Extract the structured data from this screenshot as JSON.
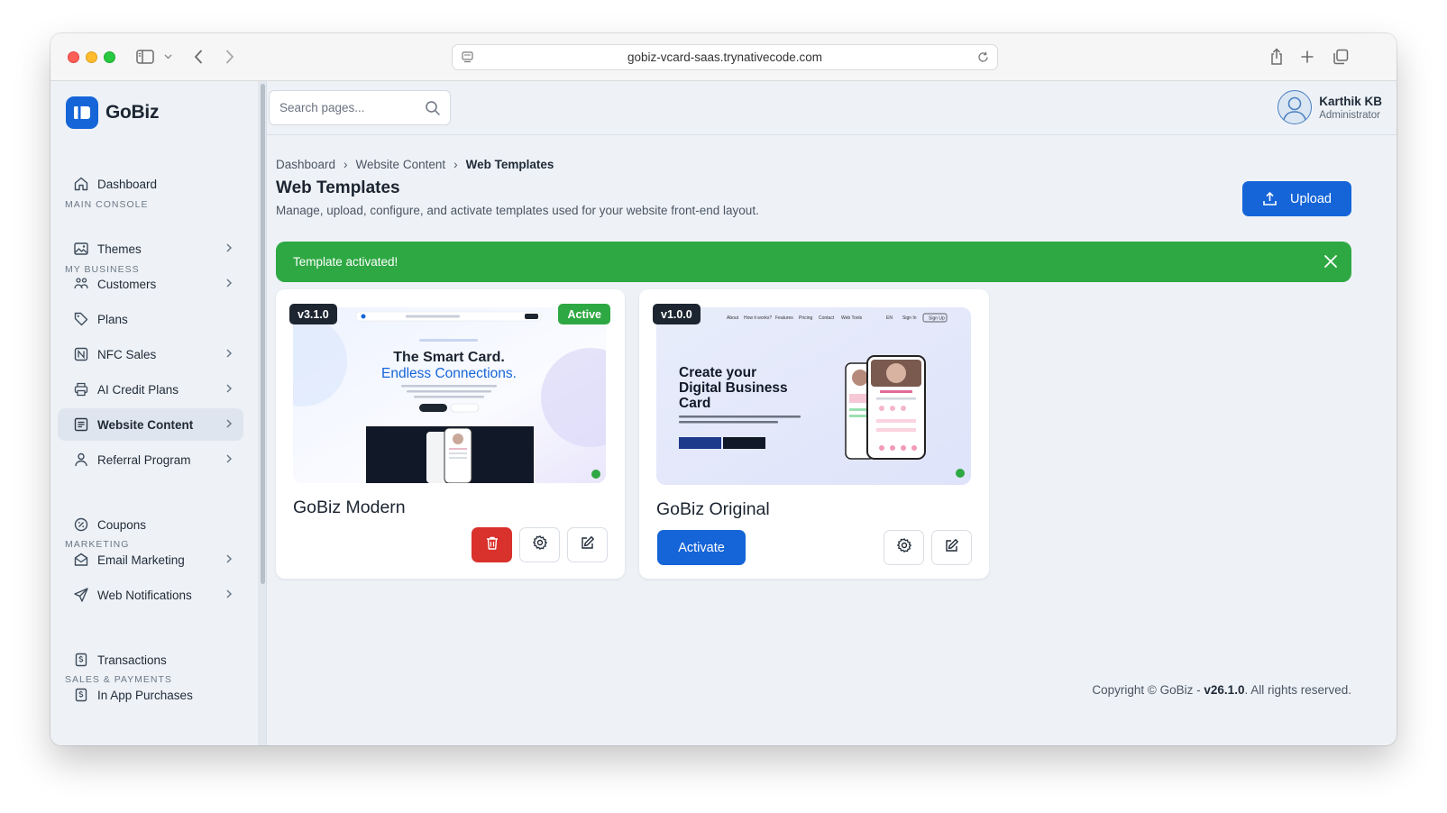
{
  "browser": {
    "url": "gobiz-vcard-saas.trynativecode.com"
  },
  "brand": {
    "name": "GoBiz",
    "color": "#1565d8"
  },
  "sidebar": {
    "sections": [
      {
        "label": "MAIN CONSOLE",
        "items": [
          {
            "label": "Dashboard",
            "icon": "home-icon",
            "has_chevron": false
          }
        ]
      },
      {
        "label": "MY BUSINESS",
        "items": [
          {
            "label": "Themes",
            "icon": "image-icon",
            "has_chevron": true
          },
          {
            "label": "Customers",
            "icon": "users-icon",
            "has_chevron": true
          },
          {
            "label": "Plans",
            "icon": "tag-icon",
            "has_chevron": false
          },
          {
            "label": "NFC Sales",
            "icon": "nfc-icon",
            "has_chevron": true
          },
          {
            "label": "AI Credit Plans",
            "icon": "printer-icon",
            "has_chevron": true
          },
          {
            "label": "Website Content",
            "icon": "content-icon",
            "has_chevron": true,
            "active": true
          },
          {
            "label": "Referral Program",
            "icon": "user-icon",
            "has_chevron": true
          }
        ]
      },
      {
        "label": "MARKETING",
        "items": [
          {
            "label": "Coupons",
            "icon": "percent-icon",
            "has_chevron": false
          },
          {
            "label": "Email Marketing",
            "icon": "mail-icon",
            "has_chevron": true
          },
          {
            "label": "Web Notifications",
            "icon": "send-icon",
            "has_chevron": true
          }
        ]
      },
      {
        "label": "SALES & PAYMENTS",
        "items": [
          {
            "label": "Transactions",
            "icon": "receipt-icon",
            "has_chevron": false
          },
          {
            "label": "In App Purchases",
            "icon": "receipt-icon",
            "has_chevron": false
          }
        ]
      }
    ]
  },
  "header": {
    "search_placeholder": "Search pages...",
    "user_name": "Karthik KB",
    "user_role": "Administrator"
  },
  "breadcrumb": [
    "Dashboard",
    "Website Content",
    "Web Templates"
  ],
  "page": {
    "title": "Web Templates",
    "subtitle": "Manage, upload, configure, and activate templates used for your website front-end layout.",
    "upload_label": "Upload"
  },
  "alert": {
    "message": "Template activated!",
    "color": "#2ea843"
  },
  "templates": [
    {
      "version": "v3.1.0",
      "status": "Active",
      "name": "GoBiz Modern",
      "preview_headline_1": "The Smart Card.",
      "preview_headline_2": "Endless Connections."
    },
    {
      "version": "v1.0.0",
      "name": "GoBiz Original",
      "activate_label": "Activate",
      "preview_headline": "Create your Digital Business Card",
      "preview_nav": [
        "About",
        "How it works?",
        "Features",
        "Pricing",
        "Contact",
        "Web Tools",
        "EN",
        "Sign In",
        "Sign Up"
      ]
    }
  ],
  "footer": {
    "prefix": "Copyright © GoBiz - ",
    "version": "v26.1.0",
    "suffix": ". All rights reserved."
  }
}
